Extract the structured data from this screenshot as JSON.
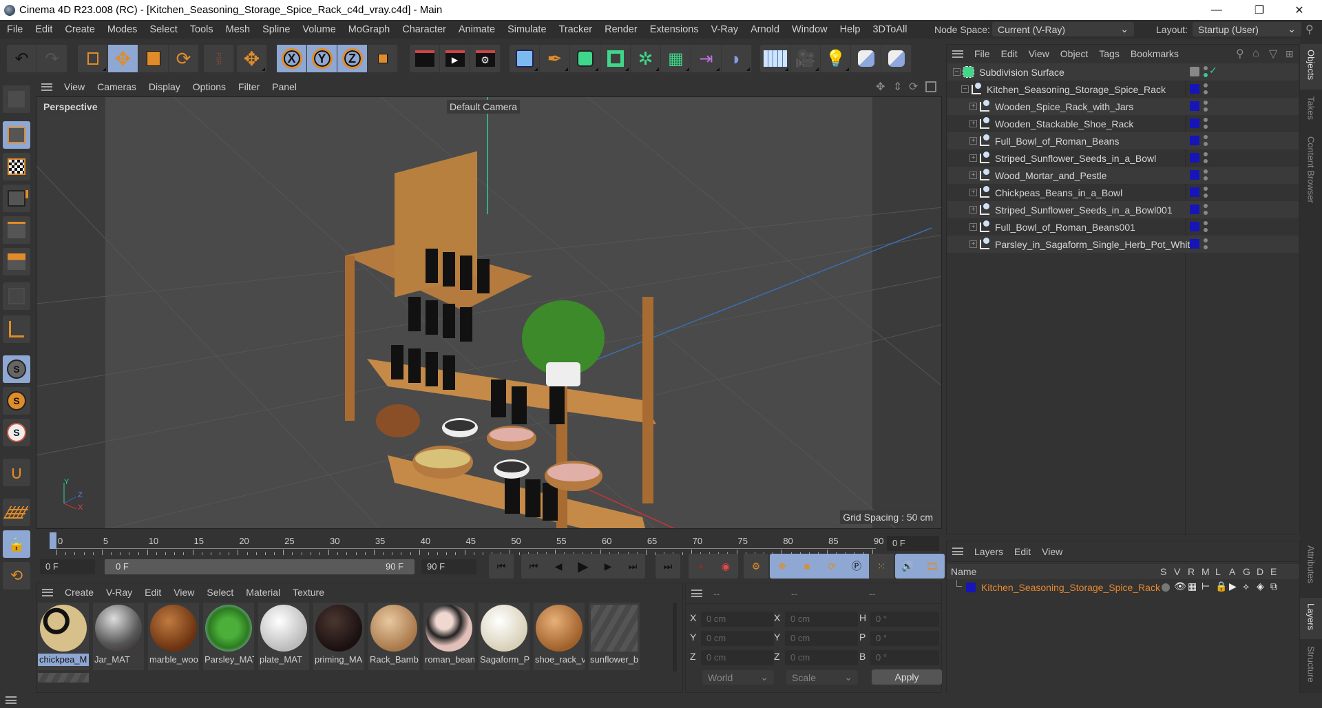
{
  "window": {
    "title": "Cinema 4D R23.008 (RC) - [Kitchen_Seasoning_Storage_Spice_Rack_c4d_vray.c4d] - Main",
    "minimize": "—",
    "maximize": "❐",
    "close": "✕"
  },
  "menu": [
    "File",
    "Edit",
    "Create",
    "Modes",
    "Select",
    "Tools",
    "Mesh",
    "Spline",
    "Volume",
    "MoGraph",
    "Character",
    "Animate",
    "Simulate",
    "Tracker",
    "Render",
    "Extensions",
    "V-Ray",
    "Arnold",
    "Window",
    "Help",
    "3DToAll"
  ],
  "node_space": {
    "label": "Node Space:",
    "value": "Current (V-Ray)"
  },
  "layout": {
    "label": "Layout:",
    "value": "Startup (User)"
  },
  "toolbar": {
    "undo": "undo-icon",
    "redo": "redo-icon",
    "axis_x": "X",
    "axis_y": "Y",
    "axis_z": "Z",
    "psr": "PSR"
  },
  "viewport": {
    "menu": [
      "View",
      "Cameras",
      "Display",
      "Options",
      "Filter",
      "Panel"
    ],
    "view_name": "Perspective",
    "camera": "Default Camera",
    "grid_spacing": "Grid Spacing : 50 cm",
    "axis_labels": {
      "y": "Y",
      "z": "Z",
      "x": "X"
    }
  },
  "timeline": {
    "ticks": [
      "0",
      "5",
      "10",
      "15",
      "20",
      "25",
      "30",
      "35",
      "40",
      "45",
      "50",
      "55",
      "60",
      "65",
      "70",
      "75",
      "80",
      "85",
      "90"
    ],
    "current_frame": "0 F",
    "start_field": "0 F",
    "range_start": "0 F",
    "range_end": "90 F",
    "end_field": "90 F"
  },
  "materials": {
    "menu": [
      "Create",
      "V-Ray",
      "Edit",
      "View",
      "Select",
      "Material",
      "Texture"
    ],
    "items": [
      {
        "label": "chickpea_M",
        "selected": true
      },
      {
        "label": "Jar_MAT"
      },
      {
        "label": "marble_woo"
      },
      {
        "label": "Parsley_MAT"
      },
      {
        "label": "plate_MAT"
      },
      {
        "label": "priming_MA"
      },
      {
        "label": "Rack_Bamb"
      },
      {
        "label": "roman_bean"
      },
      {
        "label": "Sagaform_P"
      },
      {
        "label": "shoe_rack_v"
      },
      {
        "label": "sunflower_b"
      }
    ]
  },
  "coords": {
    "headers": [
      "--",
      "--",
      "--"
    ],
    "rows": [
      {
        "l1": "X",
        "v1": "0 cm",
        "l2": "X",
        "v2": "0 cm",
        "l3": "H",
        "v3": "0 °"
      },
      {
        "l1": "Y",
        "v1": "0 cm",
        "l2": "Y",
        "v2": "0 cm",
        "l3": "P",
        "v3": "0 °"
      },
      {
        "l1": "Z",
        "v1": "0 cm",
        "l2": "Z",
        "v2": "0 cm",
        "l3": "B",
        "v3": "0 °"
      }
    ],
    "space": "World",
    "mode": "Scale",
    "apply": "Apply"
  },
  "objects": {
    "menu": [
      "File",
      "Edit",
      "View",
      "Object",
      "Tags",
      "Bookmarks"
    ],
    "root": "Subdivision Surface",
    "group": "Kitchen_Seasoning_Storage_Spice_Rack",
    "children": [
      "Wooden_Spice_Rack_with_Jars",
      "Wooden_Stackable_Shoe_Rack",
      "Full_Bowl_of_Roman_Beans",
      "Striped_Sunflower_Seeds_in_a_Bowl",
      "Wood_Mortar_and_Pestle",
      "Chickpeas_Beans_in_a_Bowl",
      "Striped_Sunflower_Seeds_in_a_Bowl001",
      "Full_Bowl_of_Roman_Beans001",
      "Parsley_in_Sagaform_Single_Herb_Pot_White"
    ],
    "layer_color": "#1515b8"
  },
  "layers": {
    "menu": [
      "Layers",
      "Edit",
      "View"
    ],
    "name_header": "Name",
    "flag_headers": [
      "S",
      "V",
      "R",
      "M",
      "L",
      "A",
      "G",
      "D",
      "E"
    ],
    "rows": [
      {
        "name": "Kitchen_Seasoning_Storage_Spice_Rack",
        "color": "#1515b8",
        "text_color": "#e8892f"
      }
    ]
  },
  "right_tabs": {
    "top": [
      "Objects",
      "Takes",
      "Content Browser"
    ],
    "bottom": [
      "Attributes",
      "Layers",
      "Structure"
    ]
  },
  "colors": {
    "accent_selected": "#8ea7d3",
    "orange": "#e08c2a",
    "layer_blue": "#1515b8"
  }
}
